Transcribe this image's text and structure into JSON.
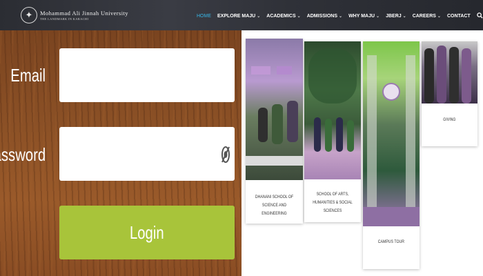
{
  "header": {
    "logo": {
      "name": "Mohammad Ali Jinnah University",
      "tagline": "THE LANDMARK IN KARACHI"
    },
    "nav": [
      {
        "label": "HOME",
        "active": true,
        "dropdown": false
      },
      {
        "label": "EXPLORE MAJU",
        "active": false,
        "dropdown": true
      },
      {
        "label": "ACADEMICS",
        "active": false,
        "dropdown": true
      },
      {
        "label": "ADMISSIONS",
        "active": false,
        "dropdown": true
      },
      {
        "label": "WHY MAJU",
        "active": false,
        "dropdown": true
      },
      {
        "label": "JBERJ",
        "active": false,
        "dropdown": true
      },
      {
        "label": "CAREERS",
        "active": false,
        "dropdown": true
      },
      {
        "label": "CONTACT",
        "active": false,
        "dropdown": false
      }
    ],
    "search_icon": "search-icon",
    "colors": {
      "bar": "#2f3138",
      "active_link": "#38b6e6"
    }
  },
  "login": {
    "email_label": "Email",
    "email_value": "",
    "password_label": "Password",
    "password_value": "",
    "password_toggle_icon": "eye-icon",
    "button_label": "Login",
    "colors": {
      "button": "#a8c43a",
      "panel": "#8c5126"
    }
  },
  "cards": [
    {
      "title": "DHANANI SCHOOL OF SCIENCE AND ENGINEERING"
    },
    {
      "title": "SCHOOL OF ARTS, HUMANITIES & SOCIAL SCIENCES"
    },
    {
      "title": "CAMPUS TOUR"
    },
    {
      "title": "GIVING"
    }
  ]
}
